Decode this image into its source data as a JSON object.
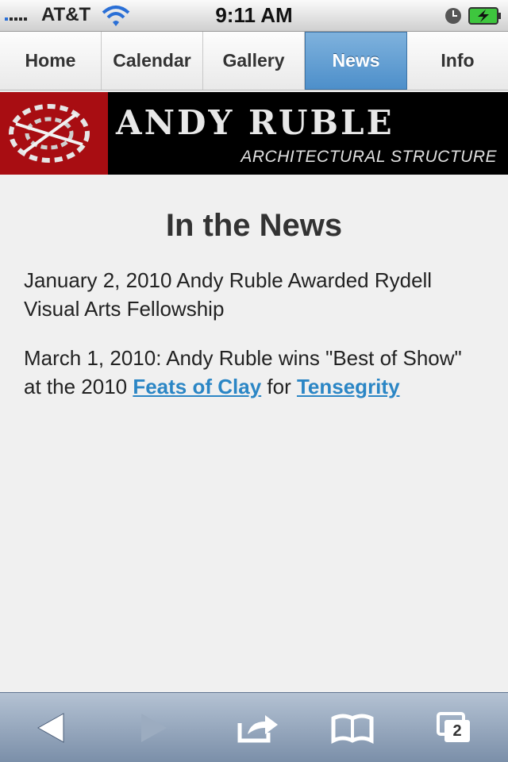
{
  "status": {
    "carrier": "AT&T",
    "time": "9:11 AM"
  },
  "nav": {
    "tabs": [
      {
        "label": "Home"
      },
      {
        "label": "Calendar"
      },
      {
        "label": "Gallery"
      },
      {
        "label": "News",
        "active": true
      },
      {
        "label": "Info"
      }
    ]
  },
  "banner": {
    "name": "ANDY RUBLE",
    "subtitle": "ARCHITECTURAL STRUCTURE"
  },
  "main": {
    "heading": "In the News",
    "item1": "January 2, 2010 Andy Ruble Awarded Rydell Visual Arts Fellowship",
    "item2_prefix": "March 1, 2010: Andy Ruble wins \"Best of Show\" at the 2010 ",
    "item2_link1": "Feats of Clay",
    "item2_middle": " for ",
    "item2_link2": "Tensegrity"
  },
  "toolbar": {
    "tabs_count": "2"
  },
  "colors": {
    "accent": "#4d8fca",
    "link": "#2b86c5",
    "banner_red": "#a80d12"
  }
}
